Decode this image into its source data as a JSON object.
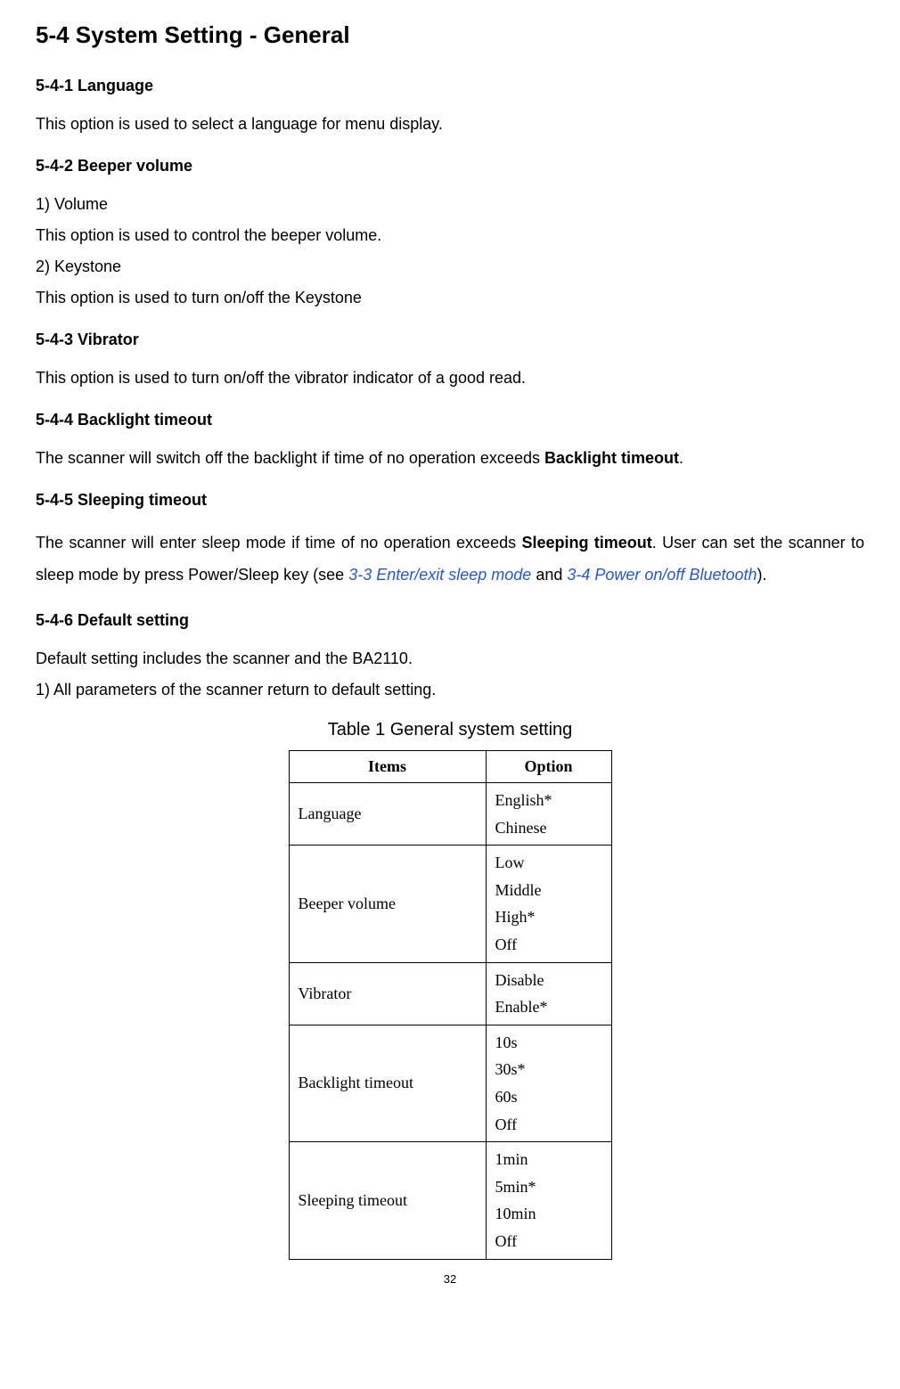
{
  "title": "5-4 System Setting - General",
  "sec1": {
    "heading": "5-4-1 Language",
    "p1": "This option is used to select a language for menu display."
  },
  "sec2": {
    "heading": "5-4-2 Beeper volume",
    "l1": "1) Volume",
    "p1": "This option is used to control the beeper volume.",
    "l2": "2) Keystone",
    "p2": "This option is used to turn on/off the Keystone"
  },
  "sec3": {
    "heading": "5-4-3 Vibrator",
    "p1": "This option is used to turn on/off the vibrator indicator of a good read."
  },
  "sec4": {
    "heading": "5-4-4 Backlight timeout",
    "p1a": "The scanner will switch off the backlight if time of no operation exceeds ",
    "p1b": "Backlight timeout",
    "p1c": "."
  },
  "sec5": {
    "heading": "5-4-5 Sleeping timeout",
    "p1a": "The scanner will enter sleep mode if time of no operation exceeds ",
    "p1b": "Sleeping timeout",
    "p1c": ". User can set the scanner to sleep mode by press Power/Sleep key (see ",
    "link1": "3-3 Enter/exit sleep mode",
    "p1d": " and ",
    "link2": "3-4 Power on/off Bluetooth",
    "p1e": ")."
  },
  "sec6": {
    "heading": "5-4-6 Default setting",
    "p1": "Default setting includes the scanner and the BA2110.",
    "p2": "1) All parameters of the scanner return to default setting."
  },
  "table": {
    "caption": "Table 1 General system setting",
    "header": {
      "items": "Items",
      "option": "Option"
    },
    "rows": [
      {
        "item": "Language",
        "options": [
          "English*",
          "Chinese"
        ]
      },
      {
        "item": "Beeper volume",
        "options": [
          "Low",
          "Middle",
          "High*",
          "Off"
        ]
      },
      {
        "item": "Vibrator",
        "options": [
          "Disable",
          "Enable*"
        ]
      },
      {
        "item": "Backlight timeout",
        "options": [
          "10s",
          "30s*",
          "60s",
          "Off"
        ]
      },
      {
        "item": "Sleeping timeout",
        "options": [
          "1min",
          "5min*",
          "10min",
          "Off"
        ]
      }
    ]
  },
  "page_number": "32"
}
